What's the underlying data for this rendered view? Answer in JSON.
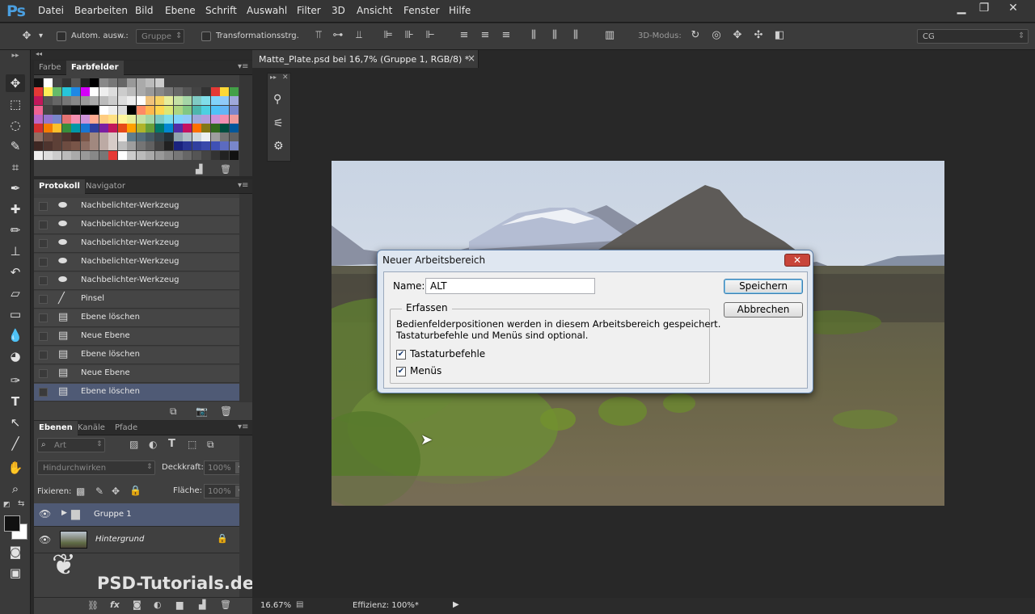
{
  "app": {
    "logo": "Ps"
  },
  "menu": [
    "Datei",
    "Bearbeiten",
    "Bild",
    "Ebene",
    "Schrift",
    "Auswahl",
    "Filter",
    "3D",
    "Ansicht",
    "Fenster",
    "Hilfe"
  ],
  "window_controls": {
    "minimize": "▁",
    "restore": "❐",
    "close": "✕"
  },
  "options_bar": {
    "auto_select_label": "Autom. ausw.:",
    "auto_select_value": "Gruppe",
    "transform_label": "Transformationsstrg.",
    "mode3d_label": "3D-Modus:",
    "workspace_value": "CG"
  },
  "swatch_panel": {
    "tabs": [
      "Farbe",
      "Farbfelder"
    ],
    "active_tab": "Farbfelder"
  },
  "history_panel": {
    "tabs": [
      "Protokoll",
      "Navigator"
    ],
    "active_tab": "Protokoll",
    "items": [
      {
        "label": "Nachbelichter-Werkzeug",
        "icon": "dodge-icon"
      },
      {
        "label": "Nachbelichter-Werkzeug",
        "icon": "dodge-icon"
      },
      {
        "label": "Nachbelichter-Werkzeug",
        "icon": "dodge-icon"
      },
      {
        "label": "Nachbelichter-Werkzeug",
        "icon": "dodge-icon"
      },
      {
        "label": "Nachbelichter-Werkzeug",
        "icon": "dodge-icon"
      },
      {
        "label": "Pinsel",
        "icon": "brush-icon"
      },
      {
        "label": "Ebene löschen",
        "icon": "document-icon"
      },
      {
        "label": "Neue Ebene",
        "icon": "document-icon"
      },
      {
        "label": "Ebene löschen",
        "icon": "document-icon"
      },
      {
        "label": "Neue Ebene",
        "icon": "document-icon"
      },
      {
        "label": "Ebene löschen",
        "icon": "document-icon",
        "selected": true
      }
    ]
  },
  "layers_panel": {
    "tabs": [
      "Ebenen",
      "Kanäle",
      "Pfade"
    ],
    "active_tab": "Ebenen",
    "filter_label": "Art",
    "blend_mode": "Hindurchwirken",
    "opacity_label": "Deckkraft:",
    "opacity_value": "100%",
    "lock_label": "Fixieren:",
    "fill_label": "Fläche:",
    "fill_value": "100%",
    "layers": [
      {
        "name": "Gruppe 1",
        "type": "group",
        "selected": true
      },
      {
        "name": "Hintergrund",
        "type": "background",
        "locked": true
      }
    ]
  },
  "document": {
    "tab_title": "Matte_Plate.psd bei 16,7% (Gruppe 1, RGB/8) *",
    "close": "×"
  },
  "status": {
    "zoom": "16.67%",
    "efficiency": "Effizienz: 100%*"
  },
  "watermark": "PSD-Tutorials.de",
  "dialog": {
    "title": "Neuer Arbeitsbereich",
    "name_label": "Name:",
    "name_value": "ALT",
    "group_label": "Erfassen",
    "description_line1": "Bedienfelderpositionen werden in diesem Arbeitsbereich gespeichert.",
    "description_line2": "Tastaturbefehle und Menüs sind optional.",
    "checkbox_keyboard": "Tastaturbefehle",
    "checkbox_menus": "Menüs",
    "keyboard_checked": true,
    "menus_checked": true,
    "save_button": "Speichern",
    "cancel_button": "Abbrechen"
  },
  "colors": {
    "accent_blue": "#4a9fe0",
    "selected_row": "#4f5a75",
    "dialog_frame": "#dfe7f1"
  }
}
